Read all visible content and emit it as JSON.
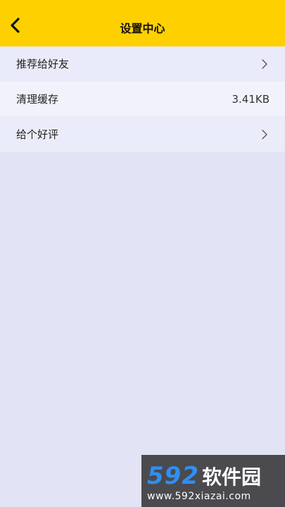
{
  "header": {
    "title": "设置中心",
    "back_icon": "chevron-left-icon",
    "background": "#ffd000"
  },
  "settings": {
    "items": [
      {
        "label": "推荐给好友",
        "value": "",
        "icon": "chevron-right-icon"
      },
      {
        "label": "清理缓存",
        "value": "3.41KB",
        "icon": ""
      },
      {
        "label": "给个好评",
        "value": "",
        "icon": "chevron-right-icon"
      }
    ]
  },
  "watermark": {
    "digits": "592",
    "name": "软件园",
    "url": "www.592xiazai.com",
    "accent": "#2f8ff0"
  }
}
